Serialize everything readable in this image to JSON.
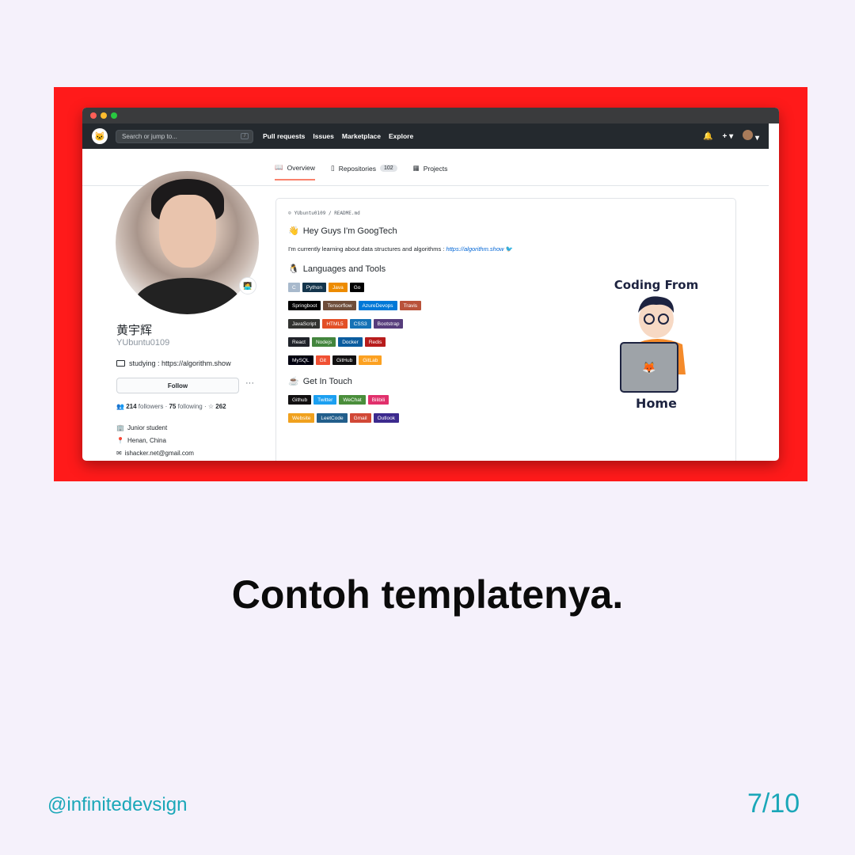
{
  "header": {
    "search_placeholder": "Search or jump to...",
    "search_key": "/",
    "nav": [
      "Pull requests",
      "Issues",
      "Marketplace",
      "Explore"
    ]
  },
  "tabs": {
    "overview": "Overview",
    "repositories": "Repositories",
    "repositories_count": "102",
    "projects": "Projects"
  },
  "profile": {
    "name": "黄宇辉",
    "login": "YUbuntu0109",
    "bio": "studying : https://algorithm.show",
    "follow_label": "Follow",
    "more": "···",
    "followers": "214",
    "followers_label": "followers ·",
    "following": "75",
    "following_label": "following ·",
    "stars": "262",
    "work": "Junior student",
    "location": "Henan, China",
    "email": "ishacker.net@gmail.com"
  },
  "readme": {
    "path": "YUbuntu0109 / README.md",
    "greeting": "Hey Guys I'm GoogTech",
    "learning_text": "I'm currently learning about data structures and algorithms :",
    "learning_link": "https://algorithm.show",
    "languages_heading": "Languages and Tools",
    "contact_heading": "Get In Touch",
    "illustration_top": "Coding From",
    "illustration_bottom": "Home",
    "badge_rows": [
      [
        {
          "label": "C",
          "color": "#a8b9cc"
        },
        {
          "label": "Python",
          "color": "#14354c"
        },
        {
          "label": "Java",
          "color": "#ed8b00"
        },
        {
          "label": "Go",
          "color": "#000000"
        }
      ],
      [
        {
          "label": "Springboot",
          "color": "#000000"
        },
        {
          "label": "Tensorflow",
          "color": "#6e4d3a"
        },
        {
          "label": "AzureDevops",
          "color": "#0078d7"
        },
        {
          "label": "Travis",
          "color": "#b9523a"
        }
      ],
      [
        {
          "label": "JavaScript",
          "color": "#323330"
        },
        {
          "label": "HTML5",
          "color": "#e34f26"
        },
        {
          "label": "CSS3",
          "color": "#1572b6"
        },
        {
          "label": "Bootstrap",
          "color": "#563d7c"
        }
      ],
      [
        {
          "label": "React",
          "color": "#20232a"
        },
        {
          "label": "Nodejs",
          "color": "#43853d"
        },
        {
          "label": "Docker",
          "color": "#0b5c9e"
        },
        {
          "label": "Redis",
          "color": "#b71c1c"
        }
      ],
      [
        {
          "label": "MySQL",
          "color": "#00000f"
        },
        {
          "label": "Git",
          "color": "#f05033"
        },
        {
          "label": "GitHub",
          "color": "#121011"
        },
        {
          "label": "GitLab",
          "color": "#fca121"
        }
      ]
    ],
    "contact_rows": [
      [
        {
          "label": "Github",
          "color": "#121011"
        },
        {
          "label": "Twitter",
          "color": "#1ca0f1"
        },
        {
          "label": "WeChat",
          "color": "#4a8e3b"
        },
        {
          "label": "Bilibili",
          "color": "#e1306c"
        }
      ],
      [
        {
          "label": "Website",
          "color": "#f0a11e"
        },
        {
          "label": "LeetCode",
          "color": "#225e8b"
        },
        {
          "label": "Gmail",
          "color": "#d14836"
        },
        {
          "label": "Outlook",
          "color": "#3c2a8e"
        }
      ]
    ]
  },
  "caption": "Contoh templatenya.",
  "handle": "@infinitedevsign",
  "page_indicator": "7/10"
}
